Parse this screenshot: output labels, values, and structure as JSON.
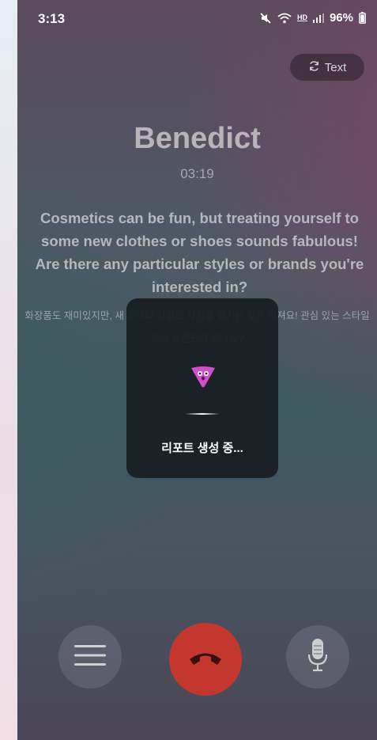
{
  "status_bar": {
    "time": "3:13",
    "battery": "96%",
    "network_badge": "HD"
  },
  "header": {
    "toggle_label": "Text"
  },
  "call": {
    "name": "Benedict",
    "duration": "03:19"
  },
  "transcript": {
    "english": "Cosmetics can be fun, but treating yourself to some new clothes or shoes sounds fabulous! Are there any particular styles or brands you're interested in?",
    "korean": "화장품도 재미있지만, 새 옷이나 신발로 자신을 챙기는 것은 멋져요! 관심 있는 스타일이나 브랜드가 있나요?"
  },
  "overlay": {
    "label": "리포트 생성 중..."
  },
  "controls": {
    "menu_icon": "menu-icon",
    "end_icon": "phone-hangup-icon",
    "mic_icon": "microphone-icon"
  },
  "colors": {
    "end_call": "#c4372f",
    "mascot": "#d050c8"
  }
}
